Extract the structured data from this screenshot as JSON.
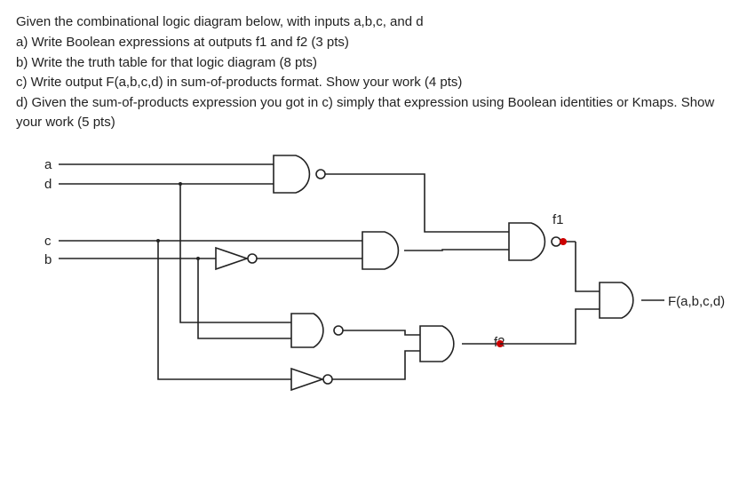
{
  "question": {
    "intro": "Given the combinational logic diagram below, with inputs a,b,c, and d",
    "part_a": "a) Write Boolean expressions at outputs f1 and f2 (3 pts)",
    "part_b": "b) Write the truth table for that logic diagram (8 pts)",
    "part_c": "c) Write output F(a,b,c,d)  in sum-of-products format. Show your work (4 pts)",
    "part_d": "d) Given the sum-of-products expression you got in c) simply that expression using Boolean identities or Kmaps. Show your work (5 pts)"
  },
  "inputs": {
    "a": "a",
    "b": "b",
    "c": "c",
    "d": "d"
  },
  "nodes": {
    "f1": "f1",
    "f2": "f2"
  },
  "output": "F(a,b,c,d)",
  "chart_data": {
    "type": "logic-diagram",
    "inputs": [
      "a",
      "b",
      "c",
      "d"
    ],
    "wires_from_inputs": {
      "a": "G1.in1",
      "d": "G1.in2; branched to G4.in1",
      "c": "G3.in1; branched to INV1.in",
      "b": "INV1.in (passes under c); and to G4.in2"
    },
    "gates": [
      {
        "id": "G1",
        "type": "NAND",
        "inputs": [
          "a",
          "d"
        ],
        "output": "n1"
      },
      {
        "id": "INV1",
        "type": "NOT",
        "inputs": [
          "b"
        ],
        "output": "nb"
      },
      {
        "id": "G3",
        "type": "AND",
        "inputs": [
          "c",
          "nb"
        ],
        "output": "n3"
      },
      {
        "id": "G2",
        "type": "NAND",
        "inputs": [
          "n1",
          "n3"
        ],
        "output": "f1"
      },
      {
        "id": "G4",
        "type": "NAND",
        "inputs": [
          "d",
          "b"
        ],
        "output": "n4"
      },
      {
        "id": "INV2",
        "type": "NOT",
        "inputs": [
          "c"
        ],
        "output": "nc"
      },
      {
        "id": "G5",
        "type": "AND",
        "inputs": [
          "n4",
          "nc"
        ],
        "output": "f2"
      },
      {
        "id": "G6",
        "type": "AND",
        "inputs": [
          "f1",
          "f2"
        ],
        "output": "F"
      }
    ],
    "marked_nodes": [
      "f1",
      "f2"
    ],
    "final_output": "F(a,b,c,d)"
  }
}
